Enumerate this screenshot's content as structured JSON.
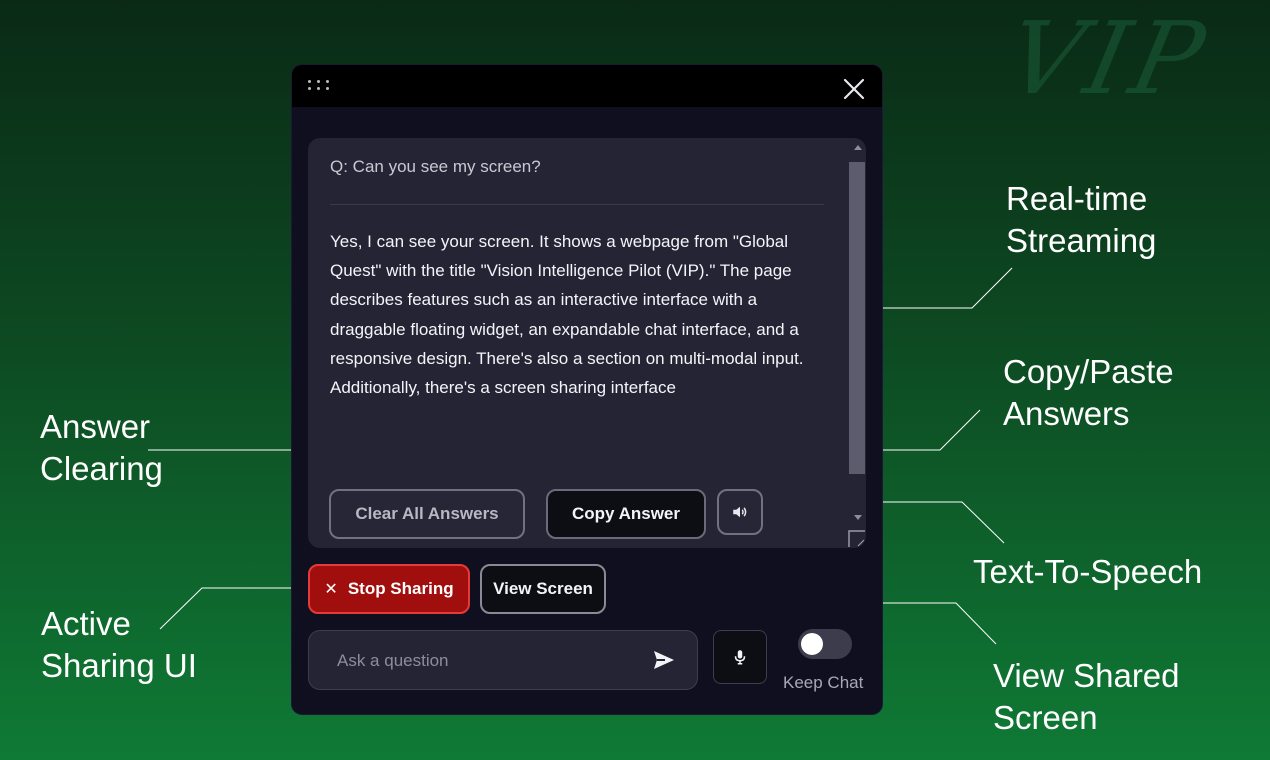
{
  "watermark": "VIP",
  "widget": {
    "question": "Q: Can you see my screen?",
    "answer": "Yes, I can see your screen. It shows a webpage from \"Global Quest\" with the title \"Vision Intelligence Pilot (VIP).\" The page describes features such as an interactive interface with a draggable floating widget, an expandable chat interface, and a responsive design. There's also a section on multi-modal input. Additionally, there's a screen sharing interface",
    "buttons": {
      "clear_all": "Clear All Answers",
      "copy": "Copy Answer",
      "stop_sharing": "Stop Sharing",
      "view_screen": "View Screen"
    },
    "input": {
      "placeholder": "Ask a question",
      "value": ""
    },
    "keep_chat": {
      "label": "Keep Chat",
      "enabled": false
    },
    "icons": [
      "drag-handle-icon",
      "close-icon",
      "speaker-icon",
      "send-icon",
      "mic-icon",
      "resize-grip-icon"
    ]
  },
  "annotations": {
    "realtime_line1": "Real-time",
    "realtime_line2": "Streaming",
    "copy_line1": "Copy/Paste",
    "copy_line2": "Answers",
    "clearing_line1": "Answer",
    "clearing_line2": "Clearing",
    "tts": "Text-To-Speech",
    "active_line1": "Active",
    "active_line2": "Sharing UI",
    "view_line1": "View Shared",
    "view_line2": "Screen"
  },
  "colors": {
    "background_top": "#0a2a16",
    "background_bottom": "#0f7a35",
    "widget_bg": "#0f0f20",
    "panel_bg": "#242435",
    "stop_button": "#a00e0e"
  }
}
